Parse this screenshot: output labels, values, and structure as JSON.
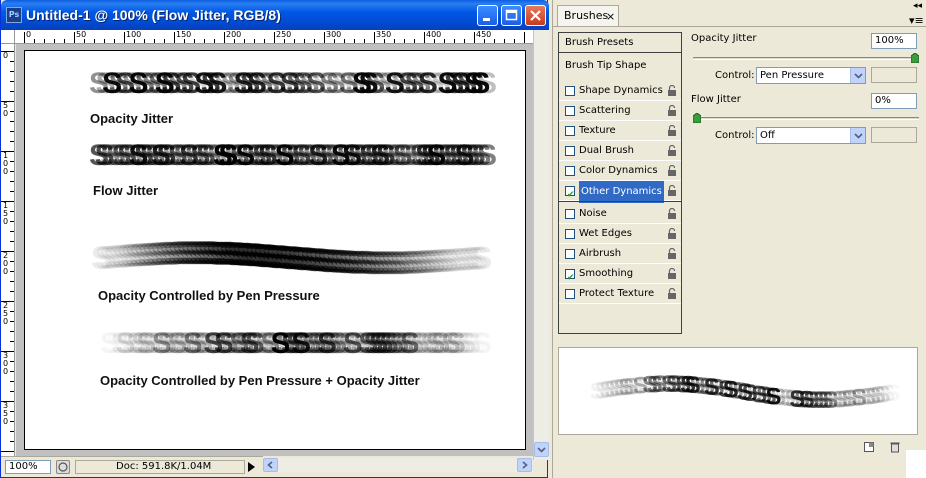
{
  "document": {
    "title": "Untitled-1 @ 100% (Flow Jitter, RGB/8)",
    "app_icon_text": "Ps",
    "ruler_top": [
      "0",
      "50",
      "100",
      "150",
      "200",
      "250",
      "300",
      "350",
      "400",
      "450"
    ],
    "ruler_left": [
      "0",
      "5\n0",
      "1\n0\n0",
      "1\n5\n0",
      "2\n0\n0",
      "2\n5\n0",
      "3\n0\n0",
      "3\n5\n0"
    ],
    "captions": [
      "Opacity Jitter",
      "Flow Jitter",
      "Opacity Controlled by Pen Pressure",
      "Opacity Controlled by Pen Pressure + Opacity Jitter"
    ],
    "status": {
      "zoom": "100%",
      "doc_info": "Doc: 591.8K/1.04M"
    }
  },
  "panel": {
    "tab_label": "Brushes",
    "tab_close": "×",
    "menu_glyph": "▾≡",
    "presets_label": "Brush Presets",
    "tip_shape_label": "Brush Tip Shape",
    "items": [
      {
        "label": "Shape Dynamics",
        "checked": false,
        "selected": false
      },
      {
        "label": "Scattering",
        "checked": false,
        "selected": false
      },
      {
        "label": "Texture",
        "checked": false,
        "selected": false
      },
      {
        "label": "Dual Brush",
        "checked": false,
        "selected": false
      },
      {
        "label": "Color Dynamics",
        "checked": false,
        "selected": false
      },
      {
        "label": "Other Dynamics",
        "checked": true,
        "selected": true
      }
    ],
    "items2": [
      {
        "label": "Noise",
        "checked": false
      },
      {
        "label": "Wet Edges",
        "checked": false
      },
      {
        "label": "Airbrush",
        "checked": false
      },
      {
        "label": "Smoothing",
        "checked": true
      },
      {
        "label": "Protect Texture",
        "checked": false
      }
    ],
    "opacity_jitter": {
      "label": "Opacity Jitter",
      "value": "100%",
      "level": 1.0,
      "control_label": "Control:",
      "control_value": "Pen Pressure"
    },
    "flow_jitter": {
      "label": "Flow Jitter",
      "value": "0%",
      "level": 0.0,
      "control_label": "Control:",
      "control_value": "Off"
    }
  },
  "colors": {
    "titlebar": "#0058e6",
    "selection": "#316ac5",
    "panel_bg": "#ece9d8"
  }
}
